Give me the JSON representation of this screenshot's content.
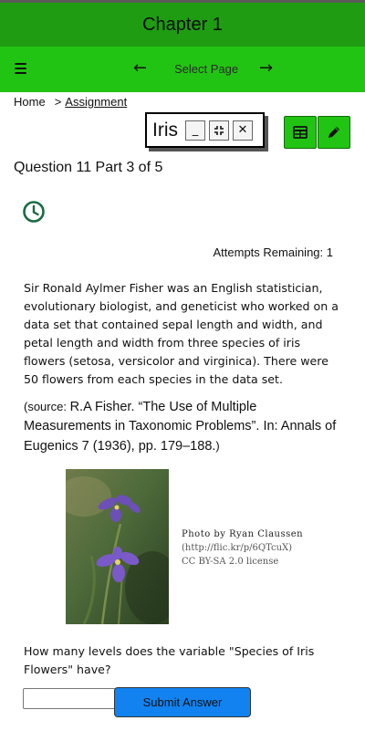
{
  "header": {
    "title": "Chapter 1"
  },
  "nav": {
    "menu_icon": "hamburger-menu-icon",
    "prev_glyph": "←",
    "select_label": "Select Page",
    "next_glyph": "→"
  },
  "breadcrumb": {
    "home": "Home",
    "separator": ">",
    "current": "Assignment"
  },
  "iris_window": {
    "title": "Iris",
    "minimize": "_",
    "collapse": "⤡",
    "close": "✕"
  },
  "tools": [
    {
      "icon": "table-icon"
    },
    {
      "icon": "pencil-icon"
    }
  ],
  "question": {
    "title": "Question 11 Part 3 of 5",
    "timer_icon": "clock-icon",
    "attempts": "Attempts Remaining: 1"
  },
  "content": {
    "paragraph": "Sir Ronald Aylmer Fisher was an English statistician, evolutionary biologist, and geneticist who worked on a data set that contained sepal length and width, and petal length and width from three species of iris flowers (setosa, versicolor and virginica). There were 50 flowers from each species in the data set.",
    "source_open": "(source: ",
    "source_body": "R.A Fisher. “The Use of Multiple Measurements in Taxonomic Problems”. In: Annals of Eugenics 7 (1936), pp. 179–188.",
    "source_close": ")",
    "photo_caption_1": "Photo by Ryan Claussen",
    "photo_caption_2": "(http://flic.kr/p/6QTcuX)",
    "photo_caption_3": "CC BY-SA 2.0 license",
    "prompt": "How many levels does the variable \"Species of Iris Flowers\" have?"
  },
  "answer": {
    "value": "",
    "placeholder": ""
  },
  "submit_label": "Submit Answer",
  "colors": {
    "title_bar": "#1f9c12",
    "nav_bar": "#22c413",
    "submit": "#1182f0",
    "clock": "#1a6b43"
  }
}
